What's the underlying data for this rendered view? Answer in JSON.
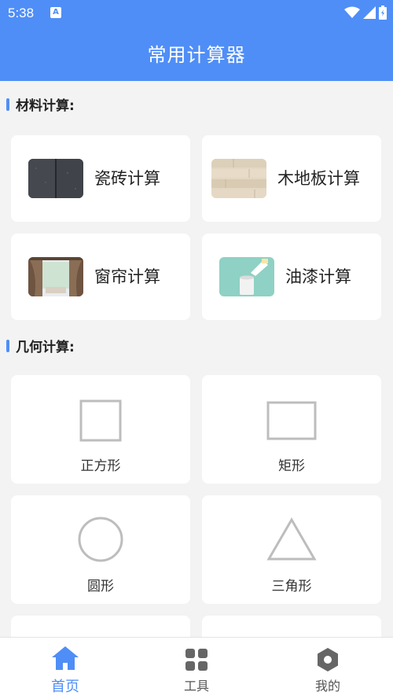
{
  "status": {
    "time": "5:38",
    "a_badge": "A"
  },
  "header": {
    "title": "常用计算器"
  },
  "sections": {
    "materials": {
      "title": "材料计算:"
    },
    "geometry": {
      "title": "几何计算:"
    }
  },
  "materials": [
    {
      "label": "瓷砖计算",
      "thumb": "tile-image"
    },
    {
      "label": "木地板计算",
      "thumb": "wood-floor-image"
    },
    {
      "label": "窗帘计算",
      "thumb": "curtain-image"
    },
    {
      "label": "油漆计算",
      "thumb": "paint-image"
    }
  ],
  "geometry": [
    {
      "label": "正方形",
      "icon": "square-icon"
    },
    {
      "label": "矩形",
      "icon": "rectangle-icon"
    },
    {
      "label": "圆形",
      "icon": "circle-icon"
    },
    {
      "label": "三角形",
      "icon": "triangle-icon"
    }
  ],
  "tabs": [
    {
      "label": "首页",
      "icon": "home-icon",
      "active": true
    },
    {
      "label": "工具",
      "icon": "grid-icon",
      "active": false
    },
    {
      "label": "我的",
      "icon": "hexagon-icon",
      "active": false
    }
  ],
  "colors": {
    "accent": "#4f8ef7",
    "background": "#f3f3f4",
    "card": "#ffffff",
    "shape_stroke": "#bdbdbd"
  }
}
